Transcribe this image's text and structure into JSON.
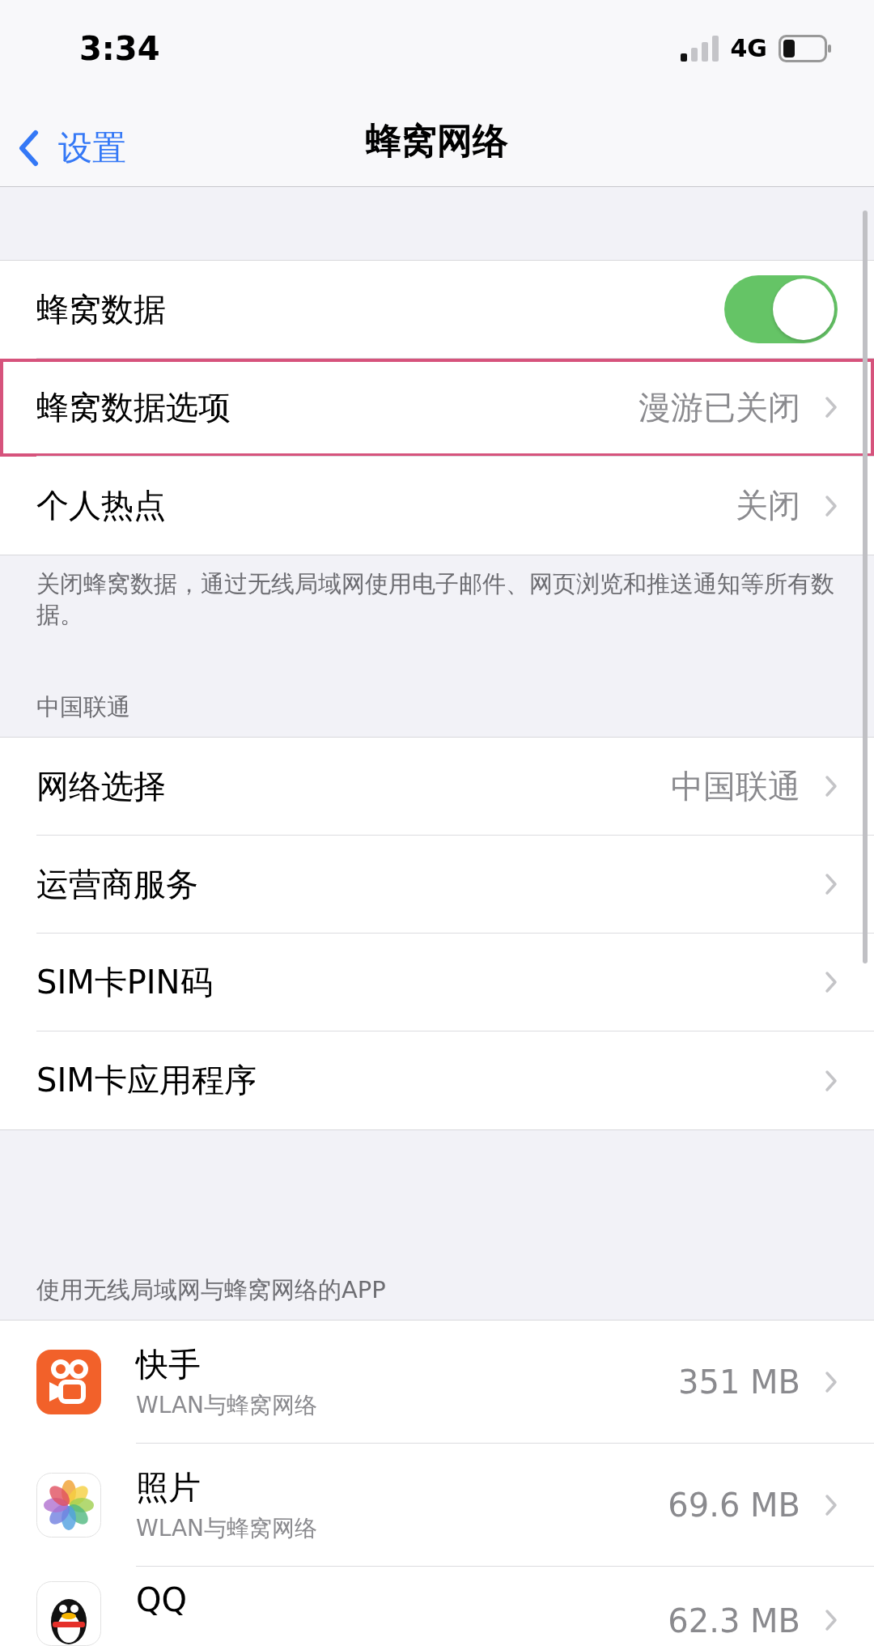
{
  "status_bar": {
    "time": "3:34",
    "network": "4G"
  },
  "nav": {
    "back": "设置",
    "title": "蜂窝网络"
  },
  "section_1": {
    "rows": [
      {
        "kind": "toggle",
        "label": "蜂窝数据",
        "on": true,
        "highlighted": false
      },
      {
        "kind": "link",
        "label": "蜂窝数据选项",
        "value": "漫游已关闭",
        "highlighted": true
      },
      {
        "kind": "link",
        "label": "个人热点",
        "value": "关闭",
        "highlighted": false
      }
    ],
    "footer": "关闭蜂窝数据，通过无线局域网使用电子邮件、网页浏览和推送通知等所有数据。"
  },
  "section_2": {
    "header": "中国联通",
    "rows": [
      {
        "kind": "link",
        "label": "网络选择",
        "value": "中国联通",
        "highlighted": false
      },
      {
        "kind": "link",
        "label": "运营商服务",
        "highlighted": false
      },
      {
        "kind": "link",
        "label": "SIM卡PIN码",
        "highlighted": false
      },
      {
        "kind": "link",
        "label": "SIM卡应用程序",
        "highlighted": false
      }
    ]
  },
  "apps_section": {
    "header": "使用无线局域网与蜂窝网络的APP",
    "apps": [
      {
        "name": "快手",
        "subtitle": "WLAN与蜂窝网络",
        "usage": "351 MB"
      },
      {
        "name": "照片",
        "subtitle": "WLAN与蜂窝网络",
        "usage": "69.6 MB"
      },
      {
        "name": "QQ",
        "usage": "62.3 MB"
      }
    ]
  }
}
